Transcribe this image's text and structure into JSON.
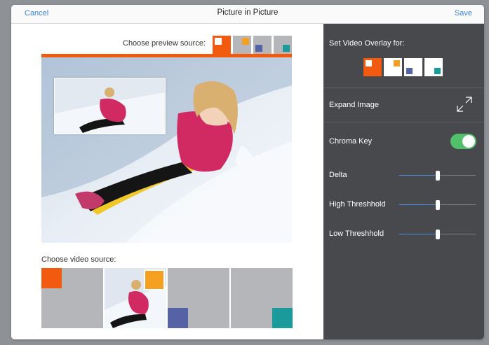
{
  "nav": {
    "cancel": "Cancel",
    "title": "Picture in Picture",
    "save": "Save"
  },
  "preview": {
    "label": "Choose preview source:",
    "sources": [
      {
        "marker_color": "#ffffff",
        "tile_color": "#f15a0f",
        "selected": true
      },
      {
        "marker_color": "#f5a020",
        "tile_color": "#b5b6b9",
        "selected": false
      },
      {
        "marker_color": "#5563a6",
        "tile_color": "#b5b6b9",
        "selected": false
      },
      {
        "marker_color": "#1a9a9a",
        "tile_color": "#b5b6b9",
        "selected": false
      }
    ]
  },
  "video": {
    "label": "Choose video source:",
    "sources": [
      {
        "marker_color": "#f15a0f"
      },
      {
        "marker_color": "#f5a020",
        "has_photo": true
      },
      {
        "marker_color": "#5563a6"
      },
      {
        "marker_color": "#1a9a9a"
      }
    ]
  },
  "settings": {
    "overlay_label": "Set Video Overlay for:",
    "overlay_options": [
      {
        "marker_color": "#ffffff",
        "bg": "#f15a0f",
        "selected": true
      },
      {
        "marker_color": "#f5a020",
        "bg": "#ffffff",
        "selected": false
      },
      {
        "marker_color": "#5563a6",
        "bg": "#ffffff",
        "selected": false
      },
      {
        "marker_color": "#1a9a9a",
        "bg": "#ffffff",
        "selected": false
      }
    ],
    "expand_label": "Expand Image",
    "chroma_label": "Chroma Key",
    "chroma_on": true,
    "sliders": [
      {
        "label": "Delta",
        "value": 0.5
      },
      {
        "label": "High Threshhold",
        "value": 0.5
      },
      {
        "label": "Low Threshhold",
        "value": 0.5
      }
    ]
  },
  "colors": {
    "accent": "#3c84d9",
    "orange": "#f15a0f",
    "panel": "#47494c",
    "toggle_on": "#52c06a"
  }
}
